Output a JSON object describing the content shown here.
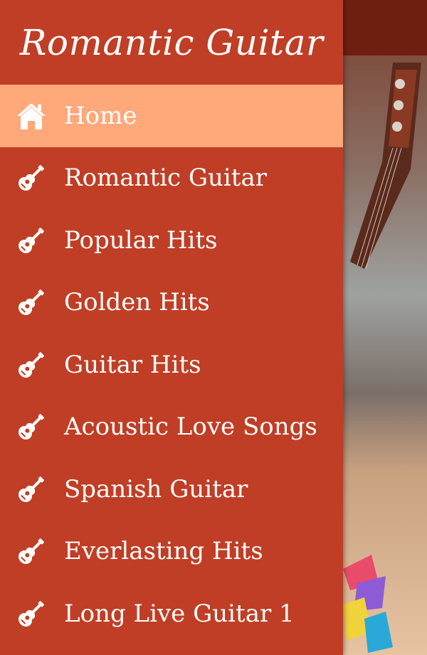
{
  "app": {
    "title": "Romantic Guitar"
  },
  "drawer": {
    "items": [
      {
        "label": "Home",
        "icon": "home-icon",
        "active": true
      },
      {
        "label": "Romantic Guitar",
        "icon": "guitar-icon",
        "active": false
      },
      {
        "label": "Popular Hits",
        "icon": "guitar-icon",
        "active": false
      },
      {
        "label": "Golden Hits",
        "icon": "guitar-icon",
        "active": false
      },
      {
        "label": "Guitar Hits",
        "icon": "guitar-icon",
        "active": false
      },
      {
        "label": "Acoustic Love Songs",
        "icon": "guitar-icon",
        "active": false
      },
      {
        "label": "Spanish Guitar",
        "icon": "guitar-icon",
        "active": false
      },
      {
        "label": "Everlasting Hits",
        "icon": "guitar-icon",
        "active": false
      },
      {
        "label": "Long Live Guitar 1",
        "icon": "guitar-icon",
        "active": false
      }
    ]
  },
  "colors": {
    "drawer_bg": "#c03e25",
    "active_item_bg": "#ffa87a",
    "text": "#ffffff",
    "appbar": "#6f1f12"
  }
}
